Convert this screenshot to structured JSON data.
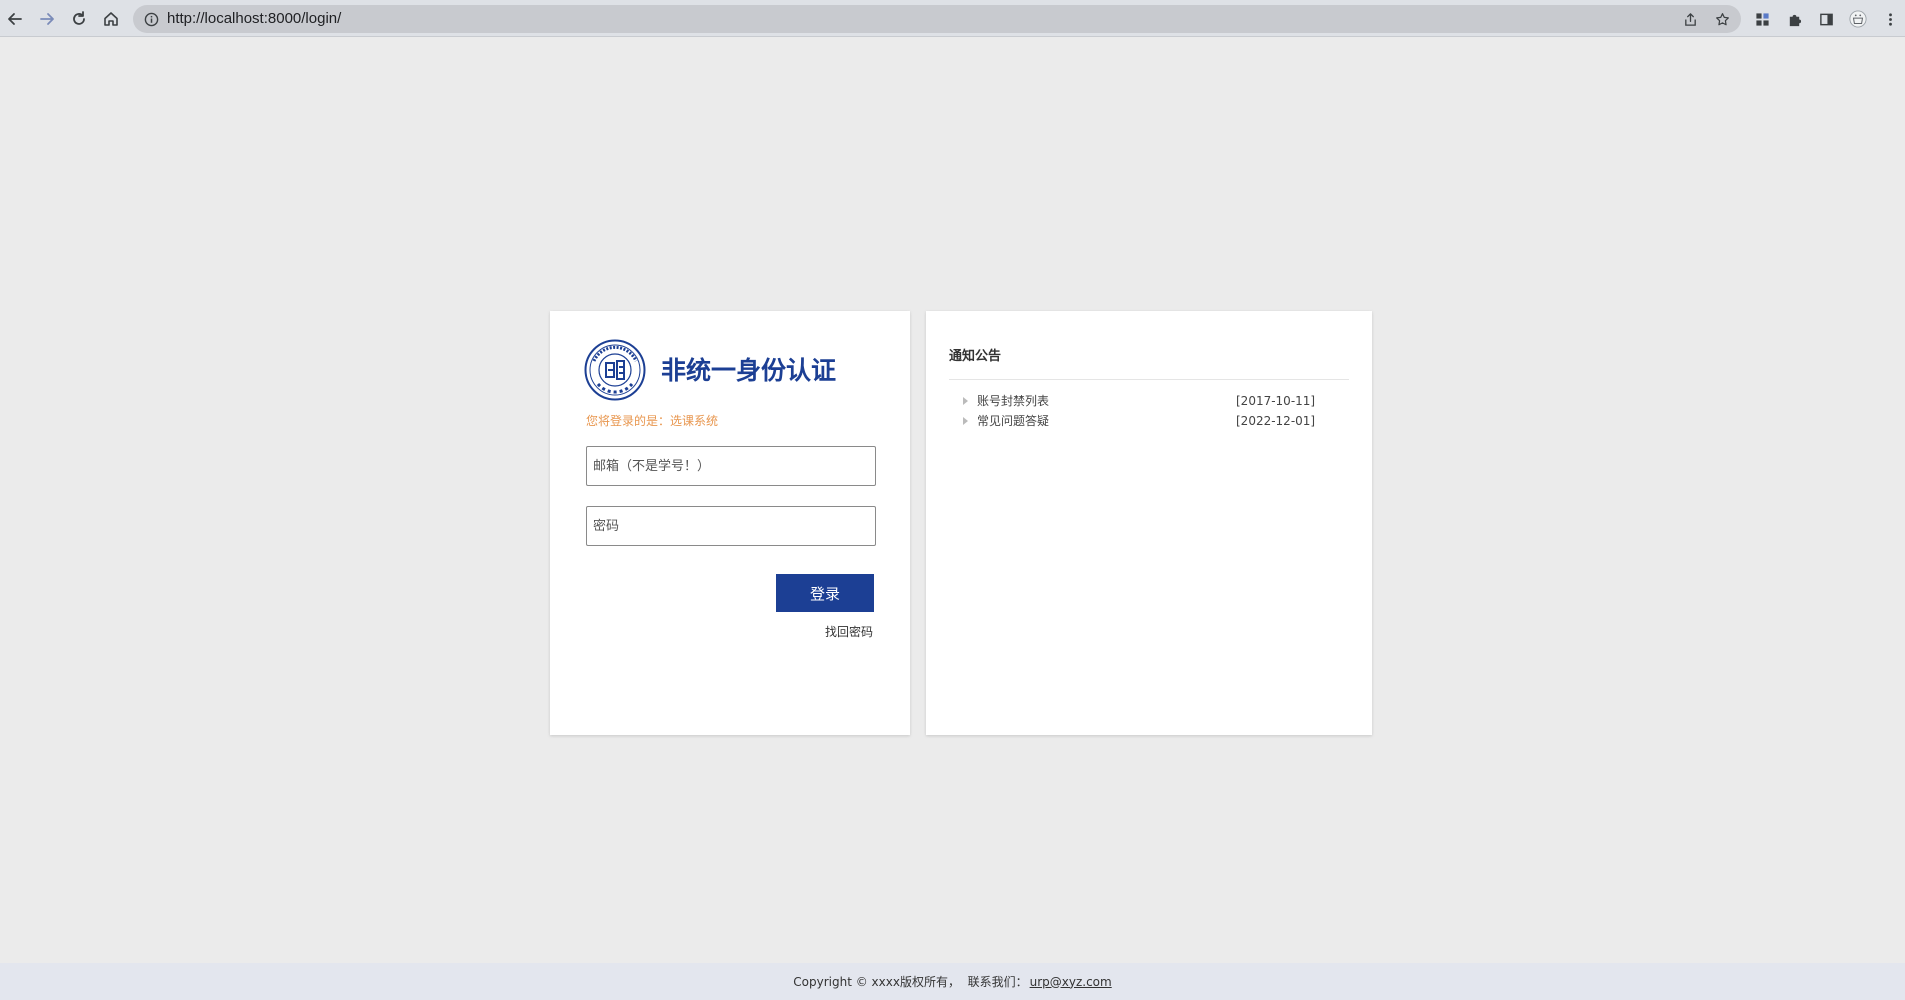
{
  "browser": {
    "url": "http://localhost:8000/login/"
  },
  "login": {
    "title": "非统一身份认证",
    "hint": "您将登录的是：选课系统",
    "email_placeholder": "邮箱（不是学号！）",
    "password_placeholder": "密码",
    "submit_label": "登录",
    "forgot_label": "找回密码"
  },
  "notice": {
    "title": "通知公告",
    "items": [
      {
        "text": "账号封禁列表",
        "date": "[2017-10-11]"
      },
      {
        "text": "常见问题答疑",
        "date": "[2022-12-01]"
      }
    ]
  },
  "footer": {
    "text": "Copyright © xxxx版权所有，  联系我们：",
    "email": "urp@xyz.com"
  },
  "colors": {
    "brand_blue": "#1c3f94",
    "hint_orange": "#e8964e",
    "page_bg": "#ebebeb",
    "footer_bg": "#e3e6ee"
  }
}
